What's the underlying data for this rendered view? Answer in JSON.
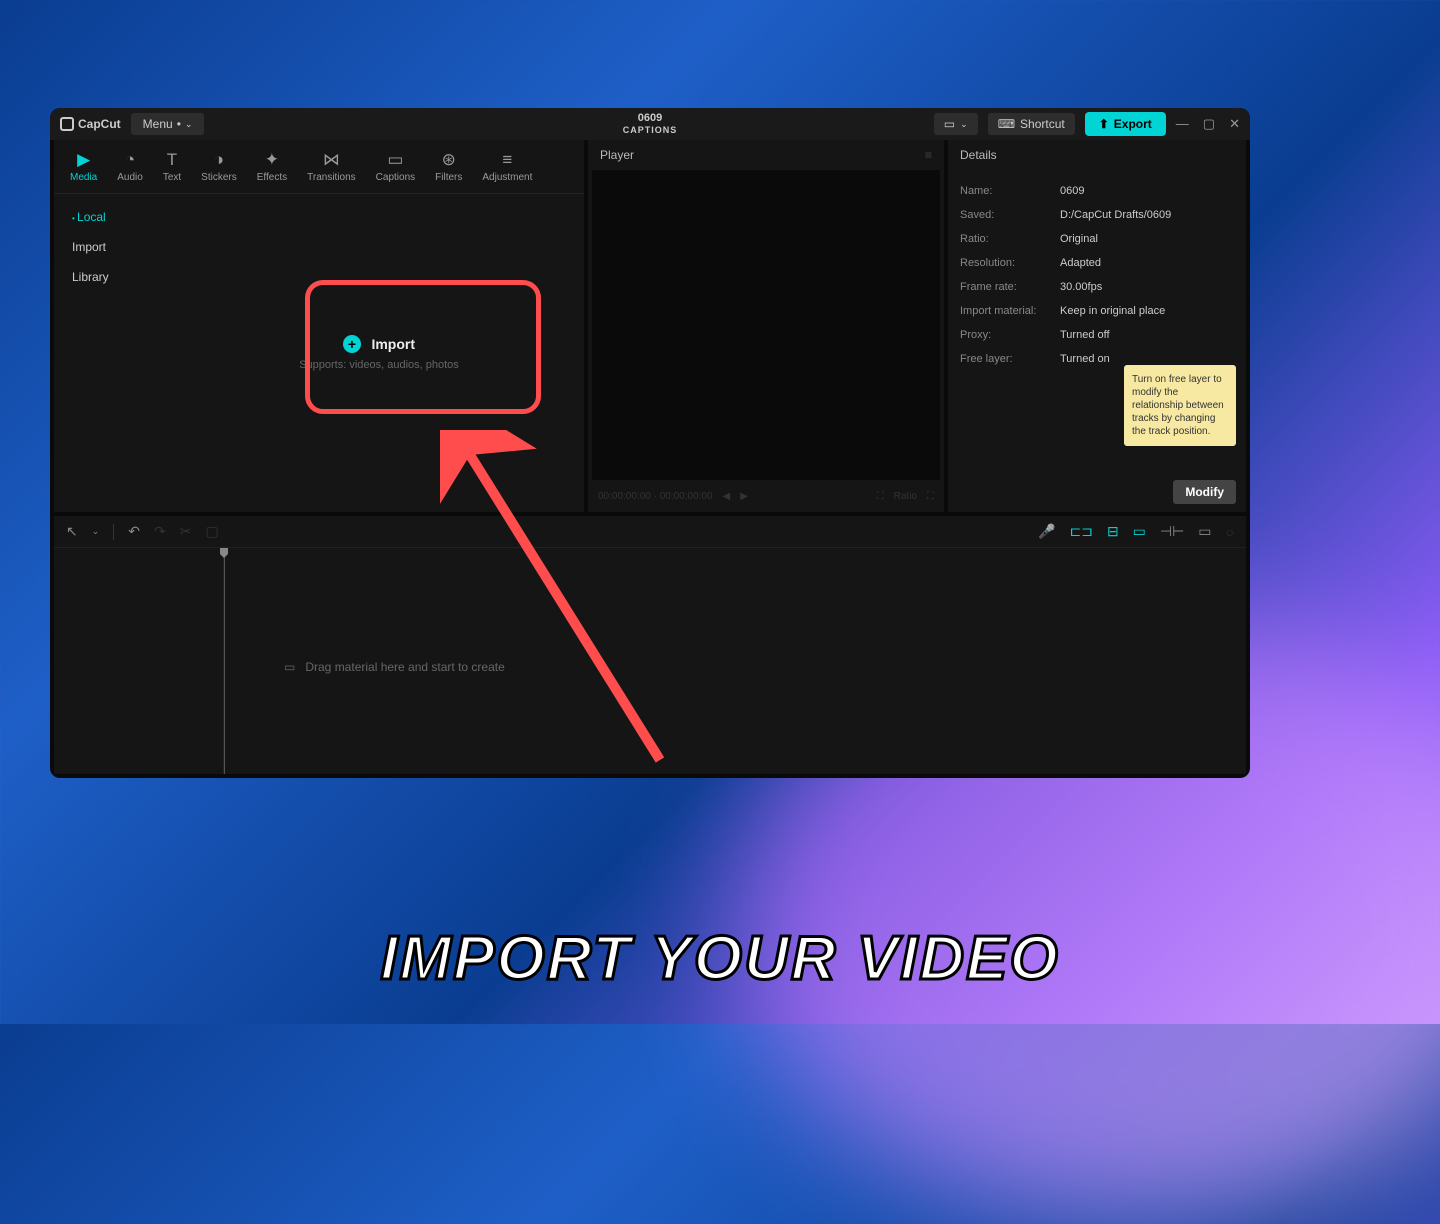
{
  "app": {
    "name": "CapCut",
    "menu": "Menu"
  },
  "title": {
    "main": "0609",
    "sub": "CAPTIONS"
  },
  "actions": {
    "shortcut": "Shortcut",
    "export": "Export"
  },
  "tabs": [
    {
      "label": "Media"
    },
    {
      "label": "Audio"
    },
    {
      "label": "Text"
    },
    {
      "label": "Stickers"
    },
    {
      "label": "Effects"
    },
    {
      "label": "Transitions"
    },
    {
      "label": "Captions"
    },
    {
      "label": "Filters"
    },
    {
      "label": "Adjustment"
    }
  ],
  "sidebar": {
    "local": "Local",
    "import": "Import",
    "library": "Library"
  },
  "import_area": {
    "label": "Import",
    "hint": "Supports: videos, audios, photos"
  },
  "player": {
    "title": "Player",
    "time": "00:00:00:00 · 00:00:00:00",
    "ratio": "Ratio"
  },
  "details": {
    "header": "Details",
    "rows": [
      {
        "label": "Name:",
        "value": "0609"
      },
      {
        "label": "Saved:",
        "value": "D:/CapCut Drafts/0609"
      },
      {
        "label": "Ratio:",
        "value": "Original"
      },
      {
        "label": "Resolution:",
        "value": "Adapted"
      },
      {
        "label": "Frame rate:",
        "value": "30.00fps"
      },
      {
        "label": "Import material:",
        "value": "Keep in original place"
      },
      {
        "label": "Proxy:",
        "value": "Turned off"
      },
      {
        "label": "Free layer:",
        "value": "Turned on"
      }
    ],
    "modify": "Modify",
    "tooltip": "Turn on free layer to modify the relationship between tracks by changing the track position."
  },
  "timeline": {
    "hint": "Drag material here and start to create"
  },
  "annotation": {
    "caption": "IMPORT YOUR VIDEO"
  }
}
